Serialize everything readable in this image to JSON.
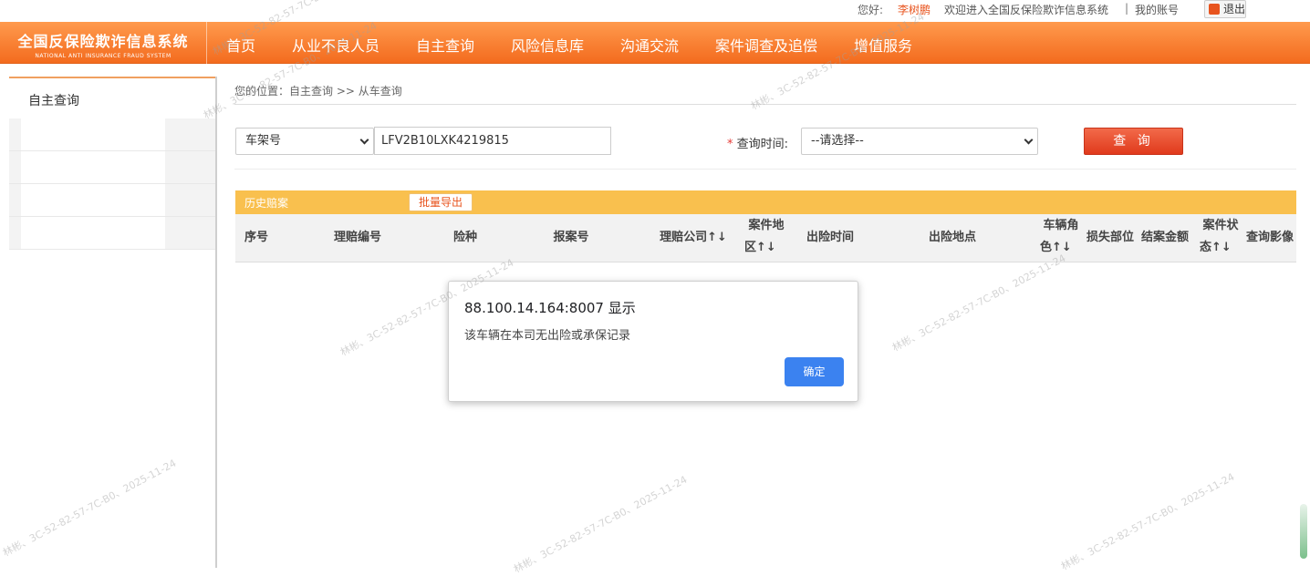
{
  "topbar": {
    "greeting": "您好:",
    "username": "李树鹏",
    "welcome": "欢迎进入全国反保险欺诈信息系统",
    "separator": "|",
    "my_account": "我的账号",
    "logout": "退出"
  },
  "logo": {
    "title": "全国反保险欺诈信息系统",
    "subtitle": "NATIONAL ANTI INSURANCE FRAUD SYSTEM"
  },
  "nav": {
    "items": [
      {
        "label": "首页"
      },
      {
        "label": "从业不良人员"
      },
      {
        "label": "自主查询"
      },
      {
        "label": "风险信息库"
      },
      {
        "label": "沟通交流"
      },
      {
        "label": "案件调查及追偿"
      },
      {
        "label": "增值服务"
      }
    ]
  },
  "sidebar": {
    "title": "自主查询"
  },
  "breadcrumb": "您的位置：自主查询 >> 从车查询",
  "search": {
    "field_type": "车架号",
    "field_value": "LFV2B10LXK4219815",
    "time_label_star": "*",
    "time_label": "查询时间:",
    "time_value": "--请选择--",
    "query_button": "查 询"
  },
  "history": {
    "title": "历史赔案",
    "export_button": "批量导出"
  },
  "table": {
    "columns": [
      {
        "l1": "序号",
        "l2": ""
      },
      {
        "l1": "理赔编号",
        "l2": ""
      },
      {
        "l1": "险种",
        "l2": ""
      },
      {
        "l1": "报案号",
        "l2": ""
      },
      {
        "l1": "理赔公司↑↓",
        "l2": ""
      },
      {
        "l1": "案件地",
        "l2": "区↑↓"
      },
      {
        "l1": "出险时间",
        "l2": ""
      },
      {
        "l1": "出险地点",
        "l2": ""
      },
      {
        "l1": "车辆角",
        "l2": "色↑↓"
      },
      {
        "l1": "损失部位",
        "l2": ""
      },
      {
        "l1": "结案金额",
        "l2": ""
      },
      {
        "l1": "案件状",
        "l2": "态↑↓"
      },
      {
        "l1": "查询影像",
        "l2": ""
      }
    ]
  },
  "dialog": {
    "title": "88.100.14.164:8007 显示",
    "message": "该车辆在本司无出险或承保记录",
    "ok_button": "确定"
  },
  "watermarks": [
    {
      "text": "林彬、3C-52-82-57-7C-B0、2025-11-24"
    },
    {
      "text": "林彬、3C-52-82-57-7C-B0、2025-11-24"
    },
    {
      "text": "林彬、3C-52-82-57-7C-B0、2025-11-24"
    },
    {
      "text": "林彬、3C-52-82-57-7C-B0、2025-11-24"
    },
    {
      "text": "林彬、3C-52-82-57-7C-B0、2025-11-24"
    },
    {
      "text": "林彬、3C-52-82-57-7C-B0、2025-11-24"
    },
    {
      "text": "林彬、3C-52-82-57-7C-B0、2025-11-24"
    },
    {
      "text": "林彬、3C-52-82-57-7C-B0、2025-11-24"
    }
  ]
}
